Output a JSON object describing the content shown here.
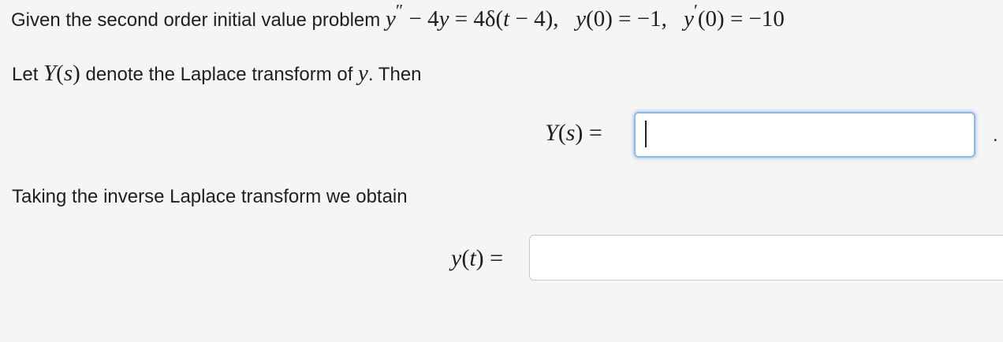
{
  "problem": {
    "intro": "Given the second order initial value problem",
    "eq_y": "y",
    "eq_prime2": "″",
    "eq_rest": " − 4",
    "eq_y2": "y",
    "eq_eq": " = 4δ(",
    "eq_t": "t",
    "eq_close": " − 4),",
    "ic1_y": "y",
    "ic1_val": "(0) = −1,",
    "ic2_y": "y",
    "ic2_prime": "′",
    "ic2_val": "(0) = −10"
  },
  "laplace_line": {
    "before": "Let ",
    "Y": "Y",
    "paren_open": "(",
    "s": "s",
    "paren_close": ")",
    "middle": " denote the Laplace transform of ",
    "y": "y",
    "after": ". Then"
  },
  "Ys_field": {
    "label_Y": "Y",
    "label_open": "(",
    "label_s": "s",
    "label_close": ") =",
    "value": "",
    "trailing": "."
  },
  "inverse_line": "Taking the inverse Laplace transform we obtain",
  "yt_field": {
    "label_y": "y",
    "label_open": "(",
    "label_t": "t",
    "label_close": ") =",
    "value": ""
  },
  "colors": {
    "background": "#f5f5f5",
    "focus_border": "#8fb8e3",
    "field_border": "#c9c9c9"
  }
}
